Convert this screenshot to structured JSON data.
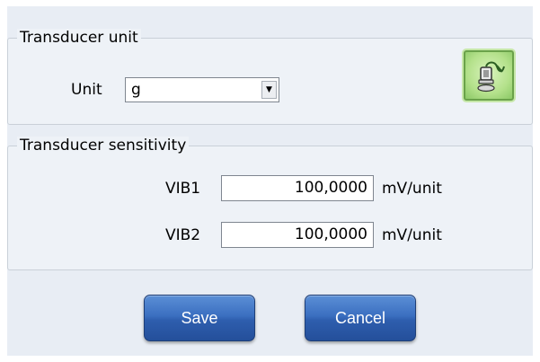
{
  "unit_group": {
    "title": "Transducer unit",
    "unit_label": "Unit",
    "unit_value": "g",
    "transducer_button_icon": "accelerometer-sensor-icon"
  },
  "sensitivity_group": {
    "title": "Transducer sensitivity",
    "rows": [
      {
        "label": "VIB1",
        "value": "100,0000",
        "unit": "mV/unit"
      },
      {
        "label": "VIB2",
        "value": "100,0000",
        "unit": "mV/unit"
      }
    ]
  },
  "buttons": {
    "save": "Save",
    "cancel": "Cancel"
  },
  "colors": {
    "panel": "#e8edf4",
    "button_blue": "#3b6fc0",
    "icon_button_green": "#b4e18b"
  }
}
